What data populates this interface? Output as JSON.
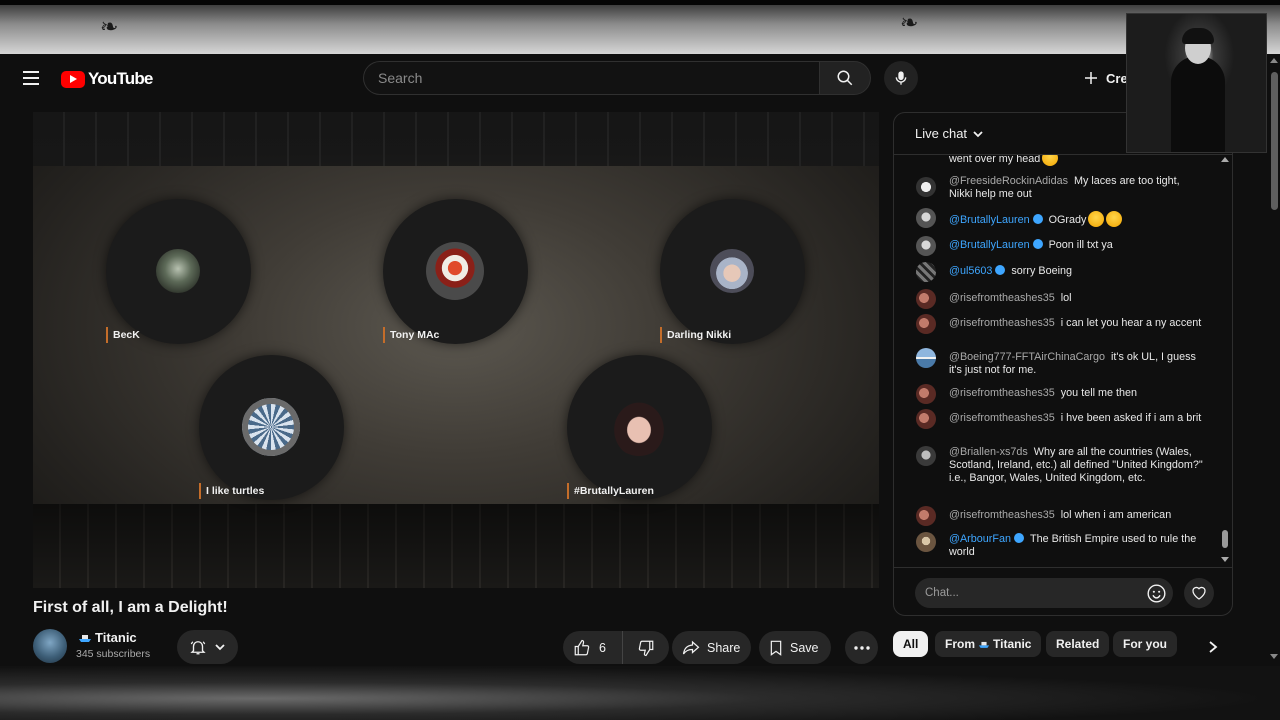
{
  "masthead": {
    "logo_text": "YouTube",
    "search_placeholder": "Search",
    "create_label": "Create"
  },
  "video": {
    "participants": [
      {
        "name": "BecK"
      },
      {
        "name": "Tony MAc"
      },
      {
        "name": "Darling Nikki"
      },
      {
        "name": "I like turtles"
      },
      {
        "name": "#BrutallyLauren"
      }
    ],
    "title": "First of all, I am a Delight!"
  },
  "channel": {
    "name": "Titanic",
    "subscribers": "345 subscribers"
  },
  "actions": {
    "like_count": "6",
    "share_label": "Share",
    "save_label": "Save"
  },
  "chat": {
    "header": "Live chat",
    "input_placeholder": "Chat...",
    "messages": [
      {
        "author": "",
        "text": "went over my head",
        "emoji": 1
      },
      {
        "author": "@FreesideRockinAdidas",
        "text": "My laces are too tight, Nikki help me out",
        "verified": false
      },
      {
        "author": "@BrutallyLauren",
        "text": "OGrady",
        "verified": true,
        "emoji": 2
      },
      {
        "author": "@BrutallyLauren",
        "text": "Poon ill txt ya",
        "verified": true
      },
      {
        "author": "@ul5603",
        "text": "sorry Boeing",
        "verified": true
      },
      {
        "author": "@risefromtheashes35",
        "text": "lol"
      },
      {
        "author": "@risefromtheashes35",
        "text": "i can let you hear a ny accent"
      },
      {
        "author": "@Boeing777-FFTAirChinaCargo",
        "text": "it's ok UL, I guess it's just not for me."
      },
      {
        "author": "@risefromtheashes35",
        "text": "you tell me then"
      },
      {
        "author": "@risefromtheashes35",
        "text": "i hve been asked if i am a brit"
      },
      {
        "author": "@Briallen-xs7ds",
        "text": "Why are all the countries (Wales, Scotland, Ireland, etc.) all defined \"United Kingdom?\" i.e., Bangor, Wales, United Kingdom, etc."
      },
      {
        "author": "@risefromtheashes35",
        "text": "lol when i am american"
      },
      {
        "author": "@ArbourFan",
        "text": "The British Empire used to rule the world",
        "verified": true
      }
    ]
  },
  "chips": [
    "All",
    "From",
    "Titanic",
    "Related",
    "For you"
  ],
  "colors": {
    "background": "#0f0f0f",
    "brand_red": "#ff0000",
    "link_blue": "#3ea6ff",
    "name_accent": "#c46d2a"
  },
  "icons": [
    "menu-icon",
    "youtube-logo-icon",
    "search-icon",
    "mic-icon",
    "plus-icon",
    "bell-icon",
    "chevron-down-icon",
    "like-icon",
    "dislike-icon",
    "share-icon",
    "save-icon",
    "more-icon",
    "emoji-icon",
    "heart-icon",
    "chevron-right-icon"
  ]
}
